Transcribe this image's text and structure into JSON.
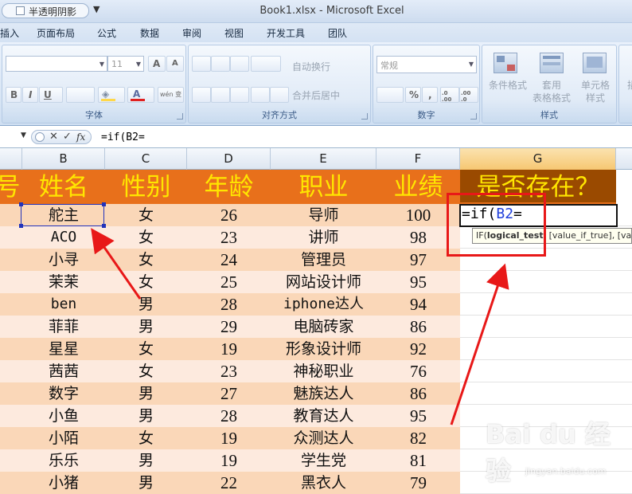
{
  "titlebar": {
    "qat_option_label": "半透明阴影",
    "qat_dropdown": "▼",
    "window_title": "Book1.xlsx - Microsoft Excel"
  },
  "ribbon_tabs": [
    "插入",
    "页面布局",
    "公式",
    "数据",
    "审阅",
    "视图",
    "开发工具",
    "团队"
  ],
  "ribbon": {
    "font_group": {
      "label": "字体",
      "font_size": "11",
      "grow_font": "A",
      "shrink_font": "A",
      "bold": "B",
      "italic": "I",
      "underline": "U",
      "font_color": "A",
      "phonetic": "wén 变"
    },
    "alignment_group": {
      "label": "对齐方式",
      "wrap_text": "自动换行",
      "merge_center": "合并后居中"
    },
    "number_group": {
      "label": "数字",
      "format": "常规",
      "percent": "%",
      "comma": ",",
      "increase_decimal": ".0 .00",
      "decrease_decimal": ".00 .0"
    },
    "styles_group": {
      "label": "样式",
      "conditional_format": "条件格式",
      "table_format_line1": "套用",
      "table_format_line2": "表格格式",
      "cell_styles_line1": "单元格",
      "cell_styles_line2": "样式"
    },
    "insert_partial": "插"
  },
  "formula_bar": {
    "cancel": "✕",
    "enter": "✓",
    "fx": "fx",
    "content": "=if(B2="
  },
  "columns": [
    "B",
    "C",
    "D",
    "E",
    "F",
    "G"
  ],
  "header_row": {
    "a_partial": "号",
    "b": "姓名",
    "c": "性别",
    "d": "年龄",
    "e": "职业",
    "f": "业绩",
    "g": "是否存在？"
  },
  "rows": [
    {
      "name": "舵主",
      "gender": "女",
      "age": "26",
      "job": "导师",
      "score": "100"
    },
    {
      "name": "ACO",
      "gender": "女",
      "age": "23",
      "job": "讲师",
      "score": "98"
    },
    {
      "name": "小寻",
      "gender": "女",
      "age": "24",
      "job": "管理员",
      "score": "97"
    },
    {
      "name": "茉茉",
      "gender": "女",
      "age": "25",
      "job": "网站设计师",
      "score": "95"
    },
    {
      "name": "ben",
      "gender": "男",
      "age": "28",
      "job": "iphone达人",
      "score": "94"
    },
    {
      "name": "菲菲",
      "gender": "男",
      "age": "29",
      "job": "电脑砖家",
      "score": "86"
    },
    {
      "name": "星星",
      "gender": "女",
      "age": "19",
      "job": "形象设计师",
      "score": "92"
    },
    {
      "name": "茜茜",
      "gender": "女",
      "age": "23",
      "job": "神秘职业",
      "score": "76"
    },
    {
      "name": "数字",
      "gender": "男",
      "age": "27",
      "job": "魅族达人",
      "score": "86"
    },
    {
      "name": "小鱼",
      "gender": "男",
      "age": "28",
      "job": "教育达人",
      "score": "95"
    },
    {
      "name": "小陌",
      "gender": "女",
      "age": "19",
      "job": "众测达人",
      "score": "82"
    },
    {
      "name": "乐乐",
      "gender": "男",
      "age": "19",
      "job": "学生党",
      "score": "81"
    },
    {
      "name": "小猪",
      "gender": "男",
      "age": "22",
      "job": "黑衣人",
      "score": "79"
    }
  ],
  "active_cell": {
    "prefix": "=if(",
    "ref": "B2",
    "suffix": "="
  },
  "tooltip": {
    "fn": "IF(",
    "current_arg": "logical_test",
    "rest": ", [value_if_true], [value_if_false])"
  },
  "watermark": {
    "brand": "Bai du 经验",
    "url": "jingyan.baidu.com"
  },
  "colors": {
    "header_fill": "#e8701b",
    "header_text": "#ffe600",
    "band_dark": "#fad7b8",
    "band_light": "#fdeade",
    "annotation_red": "#e81818",
    "ref_blue": "#1f3fdb"
  }
}
